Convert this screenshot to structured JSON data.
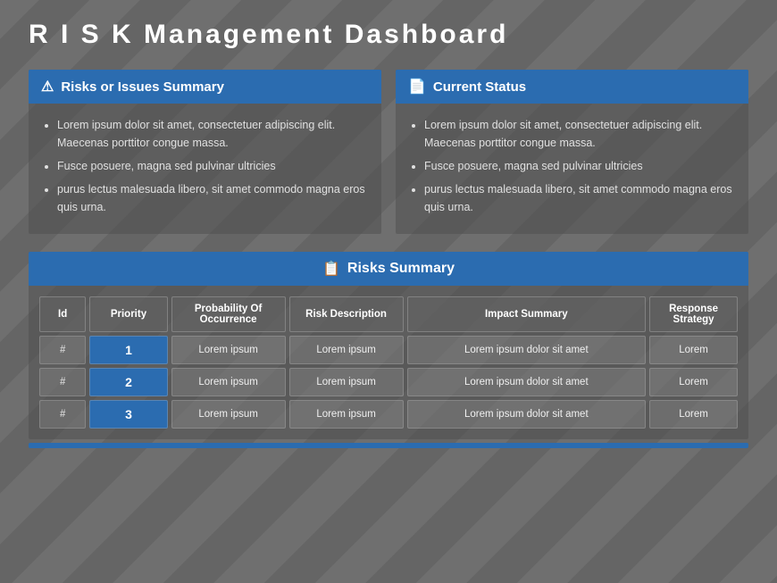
{
  "title": "R I S K  Management Dashboard",
  "top_panels": [
    {
      "id": "risks-issues",
      "header_icon": "⚠",
      "header_label": "Risks or Issues Summary",
      "bullets": [
        "Lorem ipsum dolor sit amet, consectetuer adipiscing elit. Maecenas porttitor congue massa.",
        "Fusce posuere, magna sed pulvinar ultricies",
        "purus lectus malesuada libero, sit amet commodo magna eros quis urna."
      ]
    },
    {
      "id": "current-status",
      "header_icon": "📄",
      "header_label": "Current Status",
      "bullets": [
        "Lorem ipsum dolor sit amet, consectetuer adipiscing elit. Maecenas porttitor congue massa.",
        "Fusce posuere, magna sed pulvinar ultricies",
        "purus lectus malesuada libero, sit amet commodo magna eros quis urna."
      ]
    }
  ],
  "risks_summary": {
    "header_icon": "📋",
    "header_label": "Risks Summary",
    "columns": [
      {
        "key": "id",
        "label": "Id"
      },
      {
        "key": "priority",
        "label": "Priority"
      },
      {
        "key": "probability",
        "label": "Probability Of Occurrence"
      },
      {
        "key": "description",
        "label": "Risk Description"
      },
      {
        "key": "impact",
        "label": "Impact Summary"
      },
      {
        "key": "response",
        "label": "Response Strategy"
      }
    ],
    "rows": [
      {
        "id": "#",
        "priority": "1",
        "probability": "Lorem ipsum",
        "description": "Lorem ipsum",
        "impact": "Lorem ipsum dolor sit amet",
        "response": "Lorem"
      },
      {
        "id": "#",
        "priority": "2",
        "probability": "Lorem ipsum",
        "description": "Lorem ipsum",
        "impact": "Lorem ipsum dolor sit amet",
        "response": "Lorem"
      },
      {
        "id": "#",
        "priority": "3",
        "probability": "Lorem ipsum",
        "description": "Lorem ipsum",
        "impact": "Lorem ipsum dolor sit amet",
        "response": "Lorem"
      }
    ]
  }
}
